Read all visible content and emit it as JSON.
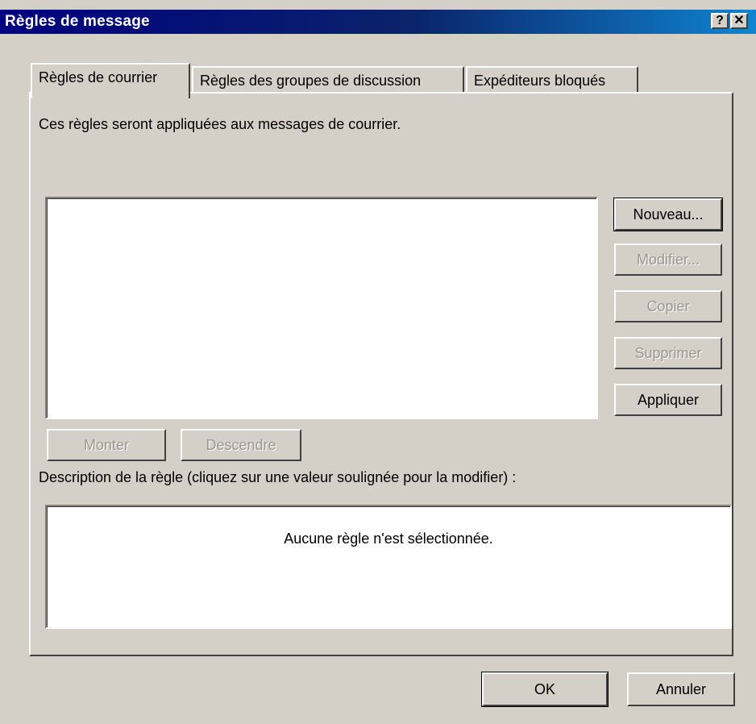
{
  "window": {
    "title": "Règles de message",
    "help_glyph": "?",
    "close_glyph": "✕"
  },
  "tabs": [
    {
      "label": "Règles de courrier",
      "active": true
    },
    {
      "label": "Règles des groupes de discussion",
      "active": false
    },
    {
      "label": "Expéditeurs bloqués",
      "active": false
    }
  ],
  "panel": {
    "intro": "Ces règles seront appliquées aux messages de courrier.",
    "rules_list": [],
    "buttons": {
      "new": "Nouveau...",
      "modify": "Modifier...",
      "copy": "Copier",
      "delete": "Supprimer",
      "apply": "Appliquer",
      "move_up": "Monter",
      "move_down": "Descendre"
    },
    "description_label": "Description de la règle (cliquez sur une valeur soulignée pour la modifier) :",
    "description_text": "Aucune règle n'est sélectionnée."
  },
  "footer": {
    "ok": "OK",
    "cancel": "Annuler"
  }
}
